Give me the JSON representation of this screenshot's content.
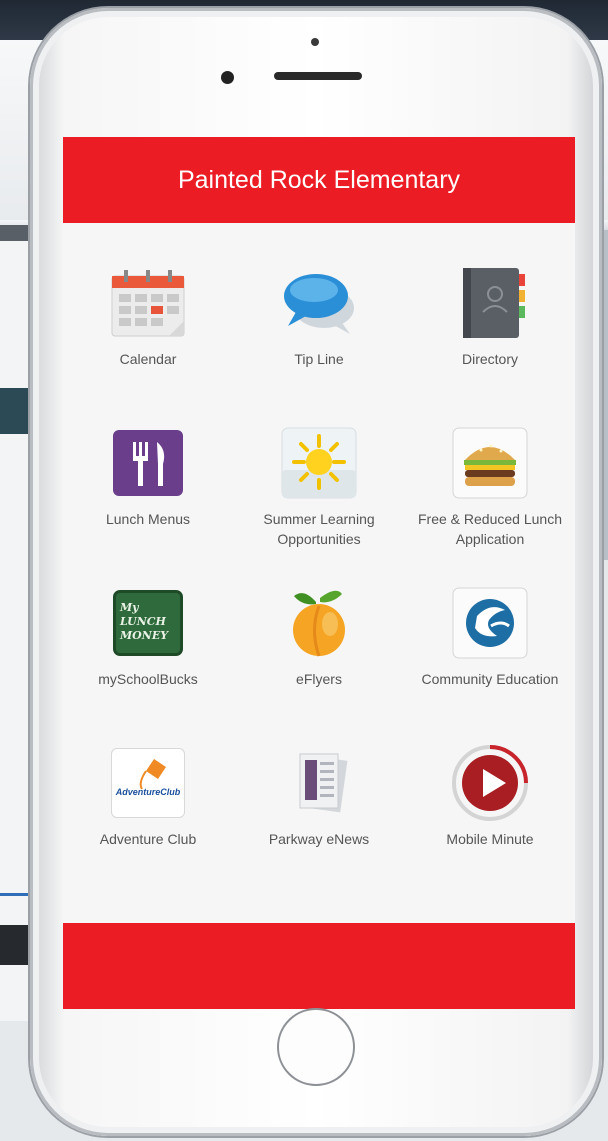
{
  "app": {
    "title": "Painted Rock Elementary"
  },
  "tiles": [
    {
      "label": "Calendar",
      "icon": "calendar-icon"
    },
    {
      "label": "Tip Line",
      "icon": "speech-bubbles-icon"
    },
    {
      "label": "Directory",
      "icon": "address-book-icon"
    },
    {
      "label": "Lunch Menus",
      "icon": "fork-knife-icon"
    },
    {
      "label": "Summer Learning Opportunities",
      "icon": "sun-icon"
    },
    {
      "label": "Free & Reduced Lunch Application",
      "icon": "burger-icon"
    },
    {
      "label": "mySchoolBucks",
      "icon": "lunch-money-chalkboard-icon",
      "text": "My LUNCH MONEY"
    },
    {
      "label": "eFlyers",
      "icon": "peach-icon"
    },
    {
      "label": "Community Education",
      "icon": "community-education-logo-icon"
    },
    {
      "label": "Adventure Club",
      "icon": "adventure-club-logo-icon",
      "text": "AdventureClub"
    },
    {
      "label": "Parkway eNews",
      "icon": "newspaper-icon"
    },
    {
      "label": "Mobile Minute",
      "icon": "play-button-icon"
    }
  ],
  "colors": {
    "brand_red": "#ec1c24",
    "screen_bg": "#f6f6f6",
    "label_text": "#555555"
  }
}
